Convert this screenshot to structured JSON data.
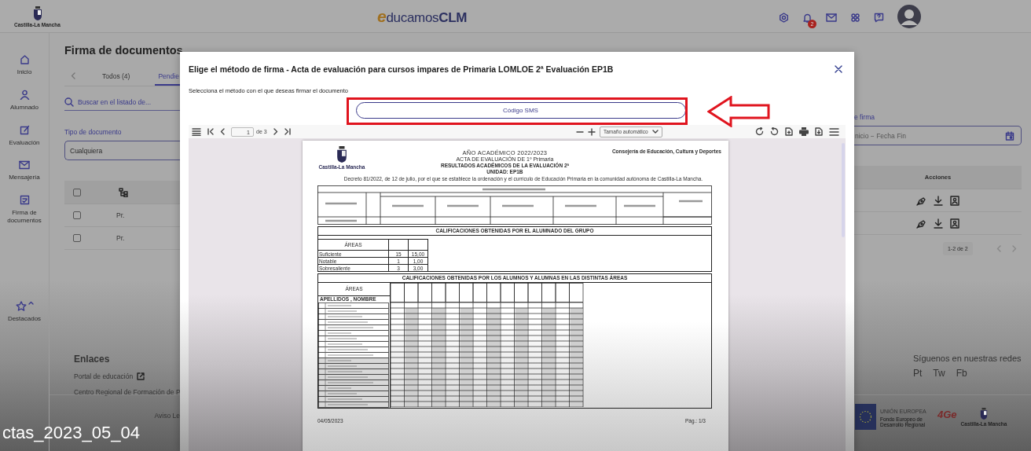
{
  "header": {
    "logo_text": "Castilla-La Mancha",
    "brand": "educamos**CLM**",
    "notification_count": "2"
  },
  "sidebar": {
    "items": [
      {
        "label": "Inicio"
      },
      {
        "label": "Alumnado"
      },
      {
        "label": "Evaluación"
      },
      {
        "label": "Mensajería"
      },
      {
        "label": "Firma de documentos"
      }
    ],
    "featured": "Destacados"
  },
  "page": {
    "title": "Firma de documentos",
    "tabs": [
      {
        "label": "Todos (4)",
        "selected": false
      },
      {
        "label": "Pendie",
        "selected": true
      }
    ],
    "search": {
      "placeholder": "Buscar en el listado de..."
    },
    "type_filter": {
      "label": "Tipo de documento",
      "value": "Cualquiera"
    },
    "date_filter": {
      "label": "e firma",
      "placeholder": "nicio − Fecha Fin"
    },
    "table": {
      "header_checked": false,
      "actions_heading": "Acciones",
      "rows": [
        {
          "checked": false,
          "cell": "Pr."
        },
        {
          "checked": false,
          "cell": "Pr."
        }
      ],
      "pagination": "1-2 de 2"
    }
  },
  "footer": {
    "links_heading": "Enlaces",
    "links": [
      "Portal de educación",
      "Centro Regional de Formación de P"
    ],
    "legal_link": "Aviso Le",
    "social_heading": "Síguenos en nuestras redes",
    "social": [
      "Pt",
      "Tw",
      "Fb"
    ],
    "eu_title": "UNIÓN EUROPEA",
    "eu_subtitle": "Fondo Europeo de Desarrollo Regional",
    "logo_4ge": "4Ge",
    "logo_text": "Castilla-La Mancha"
  },
  "dialog": {
    "title": "Elige el método de firma - Acta de evaluación para cursos impares de Primaria LOMLOE 2ª Evaluación EP1B",
    "subtitle": "Selecciona el método con el que deseas firmar el documento",
    "sms_button": "Código SMS",
    "viewer": {
      "page": "1",
      "page_count": "de 3",
      "zoom": "Tamaño automático"
    },
    "document": {
      "logo_text": "Castilla-La Mancha",
      "heading": [
        "AÑO ACADÉMICO 2022/2023",
        "ACTA DE EVALUACIÓN DE 1º Primaria",
        "RESULTADOS ACADÉMICOS DE LA EVALUACIÓN 2ª",
        "UNIDAD: EP1B"
      ],
      "department": "Consejería de Educación, Cultura y Deportes",
      "decree": "Decreto 81/2022, de 12 de julio, por el que se establece la ordenación y el currículo de Educación Primaria en la comunidad autónoma de Castilla-La Mancha.",
      "group_title": "CALIFICACIONES OBTENIDAS POR EL ALUMNADO DEL GRUPO",
      "levels_heading": "ÁREAS",
      "levels": [
        {
          "name": "Suficiente",
          "count": "15",
          "average": "15,00"
        },
        {
          "name": "Notable",
          "count": "1",
          "average": "1,00"
        },
        {
          "name": "Sobresaliente",
          "count": "3",
          "average": "3,00"
        }
      ],
      "areas_title": "CALIFICACIONES OBTENIDAS POR LOS ALUMNOS Y ALUMNAS EN LAS DISTINTAS ÁREAS",
      "areas_label": "ÁREAS",
      "names_label": "APELLIDOS , NOMBRE",
      "date": "04/05/2023",
      "page_label": "Pág.: 1/3"
    }
  },
  "caption": "ctas_2023_05_04"
}
